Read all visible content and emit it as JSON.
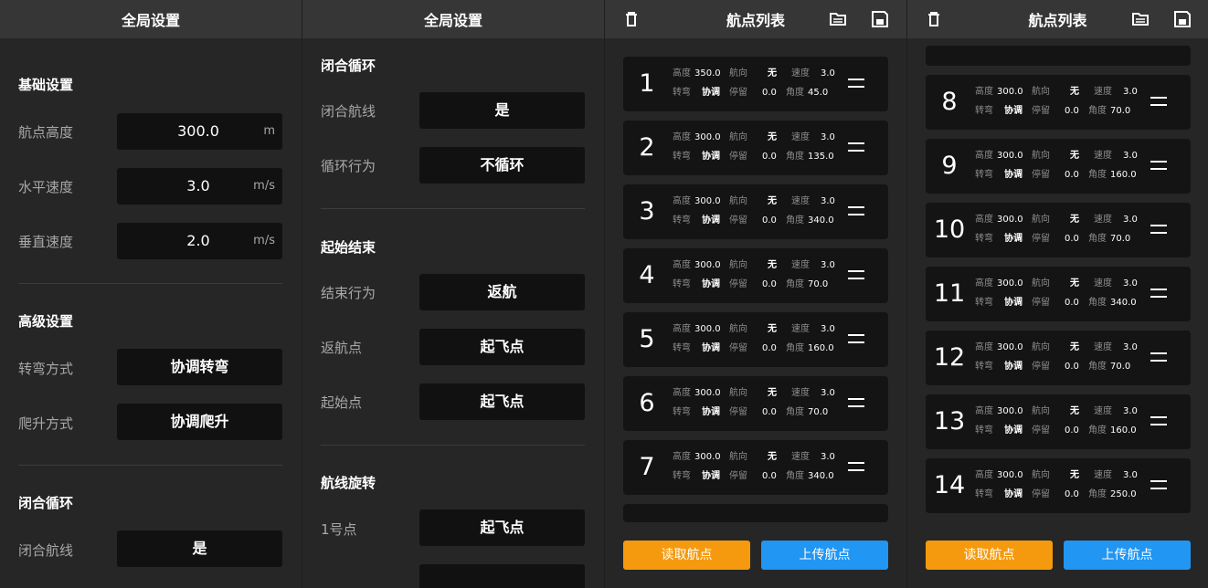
{
  "colors": {
    "background": "#262626",
    "topbar": "#363636",
    "field": "#111111",
    "card": "#141414",
    "read_button": "#f59a0e",
    "upload_button": "#2196f3",
    "label": "#a8a8a8"
  },
  "global_settings": {
    "title": "全局设置",
    "basic": {
      "title": "基础设置",
      "altitude": {
        "label": "航点高度",
        "value": "300.0",
        "unit": "m"
      },
      "hspeed": {
        "label": "水平速度",
        "value": "3.0",
        "unit": "m/s"
      },
      "vspeed": {
        "label": "垂直速度",
        "value": "2.0",
        "unit": "m/s"
      }
    },
    "advanced": {
      "title": "高级设置",
      "turn_mode": {
        "label": "转弯方式",
        "value": "协调转弯"
      },
      "climb_mode": {
        "label": "爬升方式",
        "value": "协调爬升"
      }
    },
    "loop": {
      "title": "闭合循环",
      "closed_route": {
        "label": "闭合航线",
        "value": "是"
      },
      "loop_behavior": {
        "label": "循环行为",
        "value": "不循环"
      }
    },
    "start_end": {
      "title": "起始结束",
      "end_behavior": {
        "label": "结束行为",
        "value": "返航"
      },
      "return_point": {
        "label": "返航点",
        "value": "起飞点"
      },
      "start_point": {
        "label": "起始点",
        "value": "起飞点"
      }
    },
    "rotation": {
      "title": "航线旋转",
      "point1": {
        "label": "1号点",
        "value": "起飞点"
      }
    }
  },
  "waypoint_list": {
    "title": "航点列表",
    "keys": {
      "alt": "高度",
      "heading": "航向",
      "speed": "速度",
      "turn": "转弯",
      "stay": "停留",
      "angle": "角度"
    },
    "read_button": "读取航点",
    "upload_button": "上传航点",
    "waypoints": [
      {
        "num": "1",
        "alt": "350.0",
        "heading": "无",
        "speed": "3.0",
        "turn": "协调",
        "stay": "0.0",
        "angle": "45.0"
      },
      {
        "num": "2",
        "alt": "300.0",
        "heading": "无",
        "speed": "3.0",
        "turn": "协调",
        "stay": "0.0",
        "angle": "135.0"
      },
      {
        "num": "3",
        "alt": "300.0",
        "heading": "无",
        "speed": "3.0",
        "turn": "协调",
        "stay": "0.0",
        "angle": "340.0"
      },
      {
        "num": "4",
        "alt": "300.0",
        "heading": "无",
        "speed": "3.0",
        "turn": "协调",
        "stay": "0.0",
        "angle": "70.0"
      },
      {
        "num": "5",
        "alt": "300.0",
        "heading": "无",
        "speed": "3.0",
        "turn": "协调",
        "stay": "0.0",
        "angle": "160.0"
      },
      {
        "num": "6",
        "alt": "300.0",
        "heading": "无",
        "speed": "3.0",
        "turn": "协调",
        "stay": "0.0",
        "angle": "70.0"
      },
      {
        "num": "7",
        "alt": "300.0",
        "heading": "无",
        "speed": "3.0",
        "turn": "协调",
        "stay": "0.0",
        "angle": "340.0"
      },
      {
        "num": "8",
        "alt": "300.0",
        "heading": "无",
        "speed": "3.0",
        "turn": "协调",
        "stay": "0.0",
        "angle": "70.0"
      },
      {
        "num": "9",
        "alt": "300.0",
        "heading": "无",
        "speed": "3.0",
        "turn": "协调",
        "stay": "0.0",
        "angle": "160.0"
      },
      {
        "num": "10",
        "alt": "300.0",
        "heading": "无",
        "speed": "3.0",
        "turn": "协调",
        "stay": "0.0",
        "angle": "70.0"
      },
      {
        "num": "11",
        "alt": "300.0",
        "heading": "无",
        "speed": "3.0",
        "turn": "协调",
        "stay": "0.0",
        "angle": "340.0"
      },
      {
        "num": "12",
        "alt": "300.0",
        "heading": "无",
        "speed": "3.0",
        "turn": "协调",
        "stay": "0.0",
        "angle": "70.0"
      },
      {
        "num": "13",
        "alt": "300.0",
        "heading": "无",
        "speed": "3.0",
        "turn": "协调",
        "stay": "0.0",
        "angle": "160.0"
      },
      {
        "num": "14",
        "alt": "300.0",
        "heading": "无",
        "speed": "3.0",
        "turn": "协调",
        "stay": "0.0",
        "angle": "250.0"
      }
    ]
  },
  "icons": {
    "delete": "trash-icon",
    "load": "folder-icon",
    "save": "save-icon",
    "drag": "drag-handle-icon"
  }
}
